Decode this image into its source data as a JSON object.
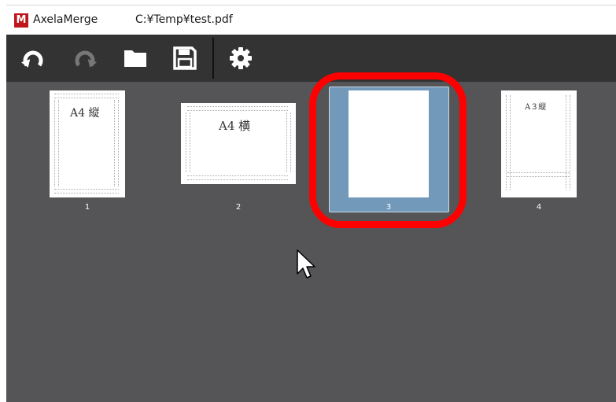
{
  "app": {
    "logo_letter": "M",
    "title": "AxelaMerge",
    "file_path": "C:¥Temp¥test.pdf"
  },
  "toolbar": {
    "buttons": [
      {
        "icon": "undo-icon",
        "enabled": true
      },
      {
        "icon": "redo-icon",
        "enabled": false
      },
      {
        "icon": "open-folder-icon",
        "enabled": true
      },
      {
        "icon": "save-icon",
        "enabled": true
      },
      {
        "icon": "settings-gear-icon",
        "enabled": true
      }
    ]
  },
  "pages": [
    {
      "number": "1",
      "label": "A4 縦",
      "selected": false
    },
    {
      "number": "2",
      "label": "A4 横",
      "selected": false
    },
    {
      "number": "3",
      "label": "",
      "selected": true
    },
    {
      "number": "4",
      "label": "A３縦",
      "selected": false
    }
  ],
  "colors": {
    "highlight": "#ff0000",
    "selection": "#7299b9",
    "workspace": "#555456",
    "toolbar": "#333333"
  }
}
